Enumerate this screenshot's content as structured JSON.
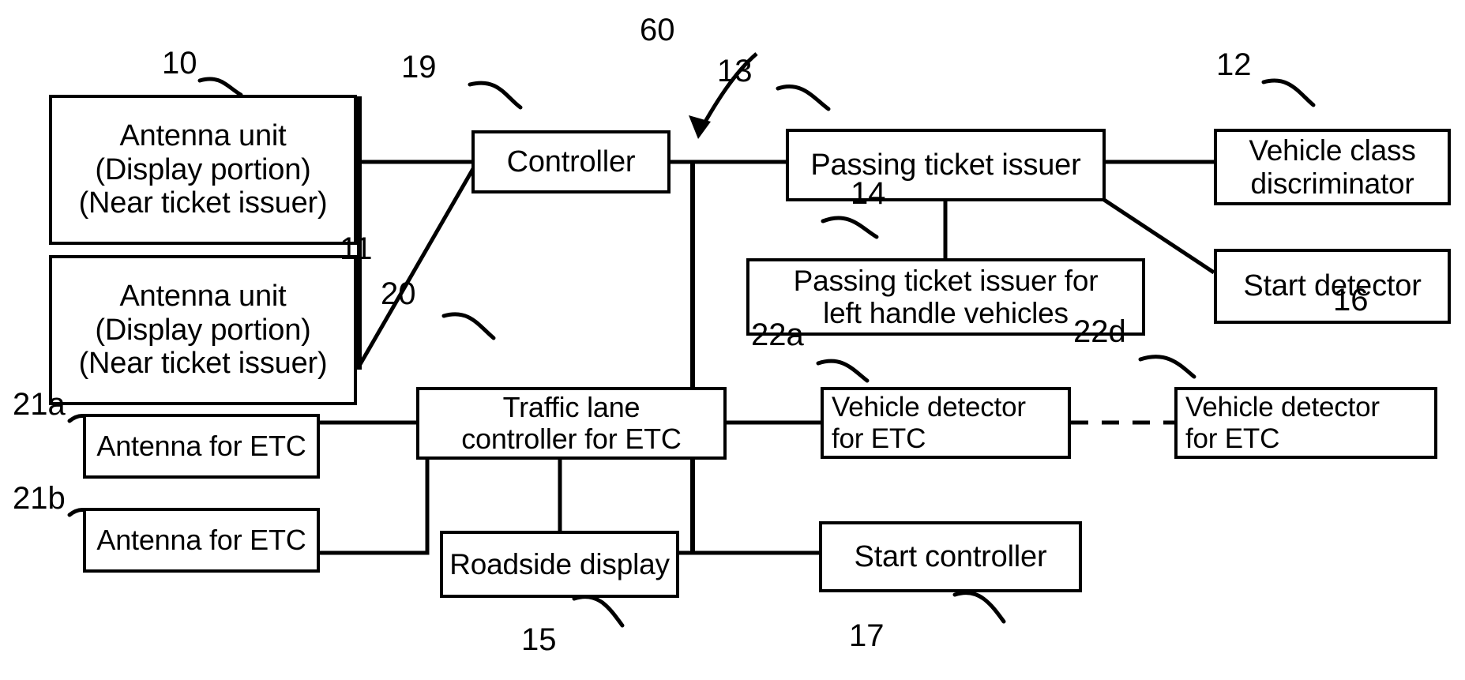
{
  "figure": {
    "type": "patent-block-diagram",
    "system_ref": "60"
  },
  "nodes": [
    {
      "id": "antenna-unit-upper",
      "ref": "10",
      "lines": [
        "Antenna unit",
        "(Display portion)",
        "(Near ticket issuer)"
      ]
    },
    {
      "id": "antenna-unit-lower",
      "ref": "11",
      "lines": [
        "Antenna unit",
        "(Display portion)",
        "(Near ticket issuer)"
      ]
    },
    {
      "id": "controller",
      "ref": "19",
      "lines": [
        "Controller"
      ]
    },
    {
      "id": "passing-ticket-issuer",
      "ref": "13",
      "lines": [
        "Passing ticket issuer"
      ]
    },
    {
      "id": "vehicle-class-discriminator",
      "ref": "12",
      "lines": [
        "Vehicle class",
        "discriminator"
      ]
    },
    {
      "id": "passing-ticket-issuer-left-handle",
      "ref": "14",
      "lines": [
        "Passing ticket issuer for",
        "left handle vehicles"
      ]
    },
    {
      "id": "start-detector",
      "ref": "16",
      "lines": [
        "Start detector"
      ]
    },
    {
      "id": "traffic-lane-controller-etc",
      "ref": "20",
      "lines": [
        "Traffic lane",
        "controller for ETC"
      ]
    },
    {
      "id": "antenna-for-etc-a",
      "ref": "21a",
      "lines": [
        "Antenna for ETC"
      ]
    },
    {
      "id": "antenna-for-etc-b",
      "ref": "21b",
      "lines": [
        "Antenna for ETC"
      ]
    },
    {
      "id": "vehicle-detector-for-etc-a",
      "ref": "22a",
      "lines": [
        "Vehicle detector",
        "for ETC"
      ]
    },
    {
      "id": "vehicle-detector-for-etc-d",
      "ref": "22d",
      "lines": [
        "Vehicle detector",
        "for ETC"
      ]
    },
    {
      "id": "roadside-display",
      "ref": "15",
      "lines": [
        "Roadside display"
      ]
    },
    {
      "id": "start-controller",
      "ref": "17",
      "lines": [
        "Start controller"
      ]
    }
  ],
  "ref_labels": {
    "system": "60",
    "antenna_upper": "10",
    "antenna_lower": "11",
    "controller": "19",
    "passing_ticket_issuer": "13",
    "vehicle_class_discriminator": "12",
    "passing_ticket_issuer_left": "14",
    "start_detector": "16",
    "traffic_lane_controller": "20",
    "antenna_etc_a": "21a",
    "antenna_etc_b": "21b",
    "vehicle_detector_a": "22a",
    "vehicle_detector_d": "22d",
    "roadside_display": "15",
    "start_controller": "17"
  },
  "colors": {
    "stroke": "#000000",
    "background": "#ffffff"
  }
}
